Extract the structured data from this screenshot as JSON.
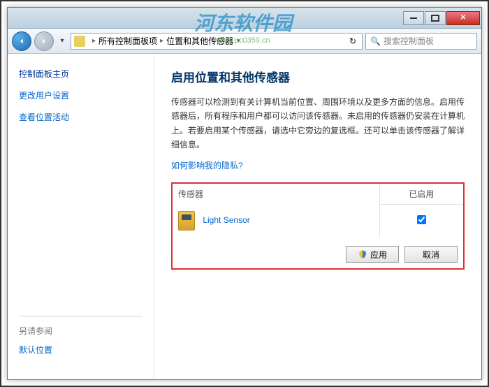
{
  "breadcrumb": {
    "item1": "所有控制面板项",
    "item2": "位置和其他传感器"
  },
  "search": {
    "placeholder": "搜索控制面板"
  },
  "sidebar": {
    "header": "控制面板主页",
    "links": [
      "更改用户设置",
      "查看位置活动"
    ],
    "footer_header": "另请参阅",
    "footer_links": [
      "默认位置"
    ]
  },
  "main": {
    "title": "启用位置和其他传感器",
    "description": "传感器可以检测到有关计算机当前位置、周围环境以及更多方面的信息。启用传感器后，所有程序和用户都可以访问该传感器。未启用的传感器仍安装在计算机上。若要启用某个传感器，请选中它旁边的复选框。还可以单击该传感器了解详细信息。",
    "help_link": "如何影响我的隐私?",
    "table": {
      "col_sensor": "传感器",
      "col_enabled": "已启用"
    },
    "sensors": [
      {
        "name": "Light Sensor",
        "enabled": true
      }
    ],
    "buttons": {
      "apply": "应用",
      "cancel": "取消"
    }
  },
  "watermark": {
    "logo": "河东软件园",
    "url": "www.pc0359.cn"
  }
}
